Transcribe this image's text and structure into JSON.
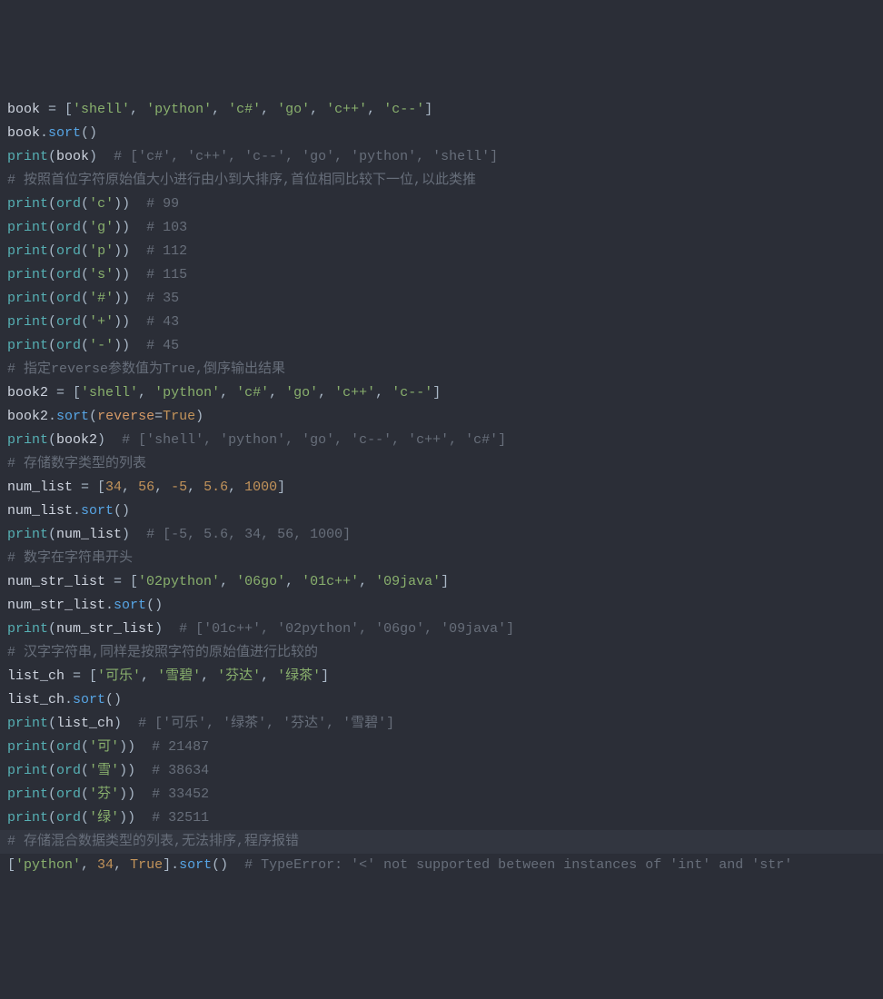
{
  "code": {
    "lines": [
      {
        "hl": false,
        "tokens": [
          {
            "c": "var",
            "t": "book"
          },
          {
            "c": "punct",
            "t": " = ["
          },
          {
            "c": "str",
            "t": "'shell'"
          },
          {
            "c": "punct",
            "t": ", "
          },
          {
            "c": "str",
            "t": "'python'"
          },
          {
            "c": "punct",
            "t": ", "
          },
          {
            "c": "str",
            "t": "'c#'"
          },
          {
            "c": "punct",
            "t": ", "
          },
          {
            "c": "str",
            "t": "'go'"
          },
          {
            "c": "punct",
            "t": ", "
          },
          {
            "c": "str",
            "t": "'c++'"
          },
          {
            "c": "punct",
            "t": ", "
          },
          {
            "c": "str",
            "t": "'c--'"
          },
          {
            "c": "punct",
            "t": "]"
          }
        ]
      },
      {
        "hl": false,
        "tokens": [
          {
            "c": "var",
            "t": "book"
          },
          {
            "c": "punct",
            "t": "."
          },
          {
            "c": "func",
            "t": "sort"
          },
          {
            "c": "punct",
            "t": "()"
          }
        ]
      },
      {
        "hl": false,
        "tokens": [
          {
            "c": "bltn",
            "t": "print"
          },
          {
            "c": "punct",
            "t": "("
          },
          {
            "c": "var",
            "t": "book"
          },
          {
            "c": "punct",
            "t": ")  "
          },
          {
            "c": "comment",
            "t": "# ['c#', 'c++', 'c--', 'go', 'python', 'shell']"
          }
        ]
      },
      {
        "hl": false,
        "tokens": [
          {
            "c": "comment",
            "t": "# 按照首位字符原始值大小进行由小到大排序,首位相同比较下一位,以此类推"
          }
        ]
      },
      {
        "hl": false,
        "tokens": [
          {
            "c": "bltn",
            "t": "print"
          },
          {
            "c": "punct",
            "t": "("
          },
          {
            "c": "bltn",
            "t": "ord"
          },
          {
            "c": "punct",
            "t": "("
          },
          {
            "c": "str",
            "t": "'c'"
          },
          {
            "c": "punct",
            "t": "))  "
          },
          {
            "c": "comment",
            "t": "# 99"
          }
        ]
      },
      {
        "hl": false,
        "tokens": [
          {
            "c": "bltn",
            "t": "print"
          },
          {
            "c": "punct",
            "t": "("
          },
          {
            "c": "bltn",
            "t": "ord"
          },
          {
            "c": "punct",
            "t": "("
          },
          {
            "c": "str",
            "t": "'g'"
          },
          {
            "c": "punct",
            "t": "))  "
          },
          {
            "c": "comment",
            "t": "# 103"
          }
        ]
      },
      {
        "hl": false,
        "tokens": [
          {
            "c": "bltn",
            "t": "print"
          },
          {
            "c": "punct",
            "t": "("
          },
          {
            "c": "bltn",
            "t": "ord"
          },
          {
            "c": "punct",
            "t": "("
          },
          {
            "c": "str",
            "t": "'p'"
          },
          {
            "c": "punct",
            "t": "))  "
          },
          {
            "c": "comment",
            "t": "# 112"
          }
        ]
      },
      {
        "hl": false,
        "tokens": [
          {
            "c": "bltn",
            "t": "print"
          },
          {
            "c": "punct",
            "t": "("
          },
          {
            "c": "bltn",
            "t": "ord"
          },
          {
            "c": "punct",
            "t": "("
          },
          {
            "c": "str",
            "t": "'s'"
          },
          {
            "c": "punct",
            "t": "))  "
          },
          {
            "c": "comment",
            "t": "# 115"
          }
        ]
      },
      {
        "hl": false,
        "tokens": [
          {
            "c": "bltn",
            "t": "print"
          },
          {
            "c": "punct",
            "t": "("
          },
          {
            "c": "bltn",
            "t": "ord"
          },
          {
            "c": "punct",
            "t": "("
          },
          {
            "c": "str",
            "t": "'#'"
          },
          {
            "c": "punct",
            "t": "))  "
          },
          {
            "c": "comment",
            "t": "# 35"
          }
        ]
      },
      {
        "hl": false,
        "tokens": [
          {
            "c": "bltn",
            "t": "print"
          },
          {
            "c": "punct",
            "t": "("
          },
          {
            "c": "bltn",
            "t": "ord"
          },
          {
            "c": "punct",
            "t": "("
          },
          {
            "c": "str",
            "t": "'+'"
          },
          {
            "c": "punct",
            "t": "))  "
          },
          {
            "c": "comment",
            "t": "# 43"
          }
        ]
      },
      {
        "hl": false,
        "tokens": [
          {
            "c": "bltn",
            "t": "print"
          },
          {
            "c": "punct",
            "t": "("
          },
          {
            "c": "bltn",
            "t": "ord"
          },
          {
            "c": "punct",
            "t": "("
          },
          {
            "c": "str",
            "t": "'-'"
          },
          {
            "c": "punct",
            "t": "))  "
          },
          {
            "c": "comment",
            "t": "# 45"
          }
        ]
      },
      {
        "hl": false,
        "tokens": [
          {
            "c": "comment",
            "t": "# 指定reverse参数值为True,倒序输出结果"
          }
        ]
      },
      {
        "hl": false,
        "tokens": [
          {
            "c": "var",
            "t": "book2"
          },
          {
            "c": "punct",
            "t": " = ["
          },
          {
            "c": "str",
            "t": "'shell'"
          },
          {
            "c": "punct",
            "t": ", "
          },
          {
            "c": "str",
            "t": "'python'"
          },
          {
            "c": "punct",
            "t": ", "
          },
          {
            "c": "str",
            "t": "'c#'"
          },
          {
            "c": "punct",
            "t": ", "
          },
          {
            "c": "str",
            "t": "'go'"
          },
          {
            "c": "punct",
            "t": ", "
          },
          {
            "c": "str",
            "t": "'c++'"
          },
          {
            "c": "punct",
            "t": ", "
          },
          {
            "c": "str",
            "t": "'c--'"
          },
          {
            "c": "punct",
            "t": "]"
          }
        ]
      },
      {
        "hl": false,
        "tokens": [
          {
            "c": "var",
            "t": "book2"
          },
          {
            "c": "punct",
            "t": "."
          },
          {
            "c": "func",
            "t": "sort"
          },
          {
            "c": "punct",
            "t": "("
          },
          {
            "c": "kwarg",
            "t": "reverse"
          },
          {
            "c": "punct",
            "t": "="
          },
          {
            "c": "bool",
            "t": "True"
          },
          {
            "c": "punct",
            "t": ")"
          }
        ]
      },
      {
        "hl": false,
        "tokens": [
          {
            "c": "bltn",
            "t": "print"
          },
          {
            "c": "punct",
            "t": "("
          },
          {
            "c": "var",
            "t": "book2"
          },
          {
            "c": "punct",
            "t": ")  "
          },
          {
            "c": "comment",
            "t": "# ['shell', 'python', 'go', 'c--', 'c++', 'c#']"
          }
        ]
      },
      {
        "hl": false,
        "tokens": [
          {
            "c": "comment",
            "t": "# 存储数字类型的列表"
          }
        ]
      },
      {
        "hl": false,
        "tokens": [
          {
            "c": "var",
            "t": "num_list"
          },
          {
            "c": "punct",
            "t": " = ["
          },
          {
            "c": "num",
            "t": "34"
          },
          {
            "c": "punct",
            "t": ", "
          },
          {
            "c": "num",
            "t": "56"
          },
          {
            "c": "punct",
            "t": ", "
          },
          {
            "c": "num",
            "t": "-5"
          },
          {
            "c": "punct",
            "t": ", "
          },
          {
            "c": "num",
            "t": "5.6"
          },
          {
            "c": "punct",
            "t": ", "
          },
          {
            "c": "num",
            "t": "1000"
          },
          {
            "c": "punct",
            "t": "]"
          }
        ]
      },
      {
        "hl": false,
        "tokens": [
          {
            "c": "var",
            "t": "num_list"
          },
          {
            "c": "punct",
            "t": "."
          },
          {
            "c": "func",
            "t": "sort"
          },
          {
            "c": "punct",
            "t": "()"
          }
        ]
      },
      {
        "hl": false,
        "tokens": [
          {
            "c": "bltn",
            "t": "print"
          },
          {
            "c": "punct",
            "t": "("
          },
          {
            "c": "var",
            "t": "num_list"
          },
          {
            "c": "punct",
            "t": ")  "
          },
          {
            "c": "comment",
            "t": "# [-5, 5.6, 34, 56, 1000]"
          }
        ]
      },
      {
        "hl": false,
        "tokens": [
          {
            "c": "comment",
            "t": "# 数字在字符串开头"
          }
        ]
      },
      {
        "hl": false,
        "tokens": [
          {
            "c": "var",
            "t": "num_str_list"
          },
          {
            "c": "punct",
            "t": " = ["
          },
          {
            "c": "str",
            "t": "'02python'"
          },
          {
            "c": "punct",
            "t": ", "
          },
          {
            "c": "str",
            "t": "'06go'"
          },
          {
            "c": "punct",
            "t": ", "
          },
          {
            "c": "str",
            "t": "'01c++'"
          },
          {
            "c": "punct",
            "t": ", "
          },
          {
            "c": "str",
            "t": "'09java'"
          },
          {
            "c": "punct",
            "t": "]"
          }
        ]
      },
      {
        "hl": false,
        "tokens": [
          {
            "c": "var",
            "t": "num_str_list"
          },
          {
            "c": "punct",
            "t": "."
          },
          {
            "c": "func",
            "t": "sort"
          },
          {
            "c": "punct",
            "t": "()"
          }
        ]
      },
      {
        "hl": false,
        "tokens": [
          {
            "c": "bltn",
            "t": "print"
          },
          {
            "c": "punct",
            "t": "("
          },
          {
            "c": "var",
            "t": "num_str_list"
          },
          {
            "c": "punct",
            "t": ")  "
          },
          {
            "c": "comment",
            "t": "# ['01c++', '02python', '06go', '09java']"
          }
        ]
      },
      {
        "hl": false,
        "tokens": [
          {
            "c": "comment",
            "t": "# 汉字字符串,同样是按照字符的原始值进行比较的"
          }
        ]
      },
      {
        "hl": false,
        "tokens": [
          {
            "c": "var",
            "t": "list_ch"
          },
          {
            "c": "punct",
            "t": " = ["
          },
          {
            "c": "str",
            "t": "'可乐'"
          },
          {
            "c": "punct",
            "t": ", "
          },
          {
            "c": "str",
            "t": "'雪碧'"
          },
          {
            "c": "punct",
            "t": ", "
          },
          {
            "c": "str",
            "t": "'芬达'"
          },
          {
            "c": "punct",
            "t": ", "
          },
          {
            "c": "str",
            "t": "'绿茶'"
          },
          {
            "c": "punct",
            "t": "]"
          }
        ]
      },
      {
        "hl": false,
        "tokens": [
          {
            "c": "var",
            "t": "list_ch"
          },
          {
            "c": "punct",
            "t": "."
          },
          {
            "c": "func",
            "t": "sort"
          },
          {
            "c": "punct",
            "t": "()"
          }
        ]
      },
      {
        "hl": false,
        "tokens": [
          {
            "c": "bltn",
            "t": "print"
          },
          {
            "c": "punct",
            "t": "("
          },
          {
            "c": "var",
            "t": "list_ch"
          },
          {
            "c": "punct",
            "t": ")  "
          },
          {
            "c": "comment",
            "t": "# ['可乐', '绿茶', '芬达', '雪碧']"
          }
        ]
      },
      {
        "hl": false,
        "tokens": [
          {
            "c": "bltn",
            "t": "print"
          },
          {
            "c": "punct",
            "t": "("
          },
          {
            "c": "bltn",
            "t": "ord"
          },
          {
            "c": "punct",
            "t": "("
          },
          {
            "c": "str",
            "t": "'可'"
          },
          {
            "c": "punct",
            "t": "))  "
          },
          {
            "c": "comment",
            "t": "# 21487"
          }
        ]
      },
      {
        "hl": false,
        "tokens": [
          {
            "c": "bltn",
            "t": "print"
          },
          {
            "c": "punct",
            "t": "("
          },
          {
            "c": "bltn",
            "t": "ord"
          },
          {
            "c": "punct",
            "t": "("
          },
          {
            "c": "str",
            "t": "'雪'"
          },
          {
            "c": "punct",
            "t": "))  "
          },
          {
            "c": "comment",
            "t": "# 38634"
          }
        ]
      },
      {
        "hl": false,
        "tokens": [
          {
            "c": "bltn",
            "t": "print"
          },
          {
            "c": "punct",
            "t": "("
          },
          {
            "c": "bltn",
            "t": "ord"
          },
          {
            "c": "punct",
            "t": "("
          },
          {
            "c": "str",
            "t": "'芬'"
          },
          {
            "c": "punct",
            "t": "))  "
          },
          {
            "c": "comment",
            "t": "# 33452"
          }
        ]
      },
      {
        "hl": false,
        "tokens": [
          {
            "c": "bltn",
            "t": "print"
          },
          {
            "c": "punct",
            "t": "("
          },
          {
            "c": "bltn",
            "t": "ord"
          },
          {
            "c": "punct",
            "t": "("
          },
          {
            "c": "str",
            "t": "'绿'"
          },
          {
            "c": "punct",
            "t": "))  "
          },
          {
            "c": "comment",
            "t": "# 32511"
          }
        ]
      },
      {
        "hl": true,
        "tokens": [
          {
            "c": "comment",
            "t": "# 存储混合数据类型的列表,无法排序,程序报错"
          }
        ]
      },
      {
        "hl": false,
        "tokens": [
          {
            "c": "punct",
            "t": "["
          },
          {
            "c": "str",
            "t": "'python'"
          },
          {
            "c": "punct",
            "t": ", "
          },
          {
            "c": "num",
            "t": "34"
          },
          {
            "c": "punct",
            "t": ", "
          },
          {
            "c": "bool",
            "t": "True"
          },
          {
            "c": "punct",
            "t": "]."
          },
          {
            "c": "func",
            "t": "sort"
          },
          {
            "c": "punct",
            "t": "()  "
          },
          {
            "c": "comment",
            "t": "# TypeError: '<' not supported between instances of 'int' and 'str'"
          }
        ]
      }
    ]
  }
}
